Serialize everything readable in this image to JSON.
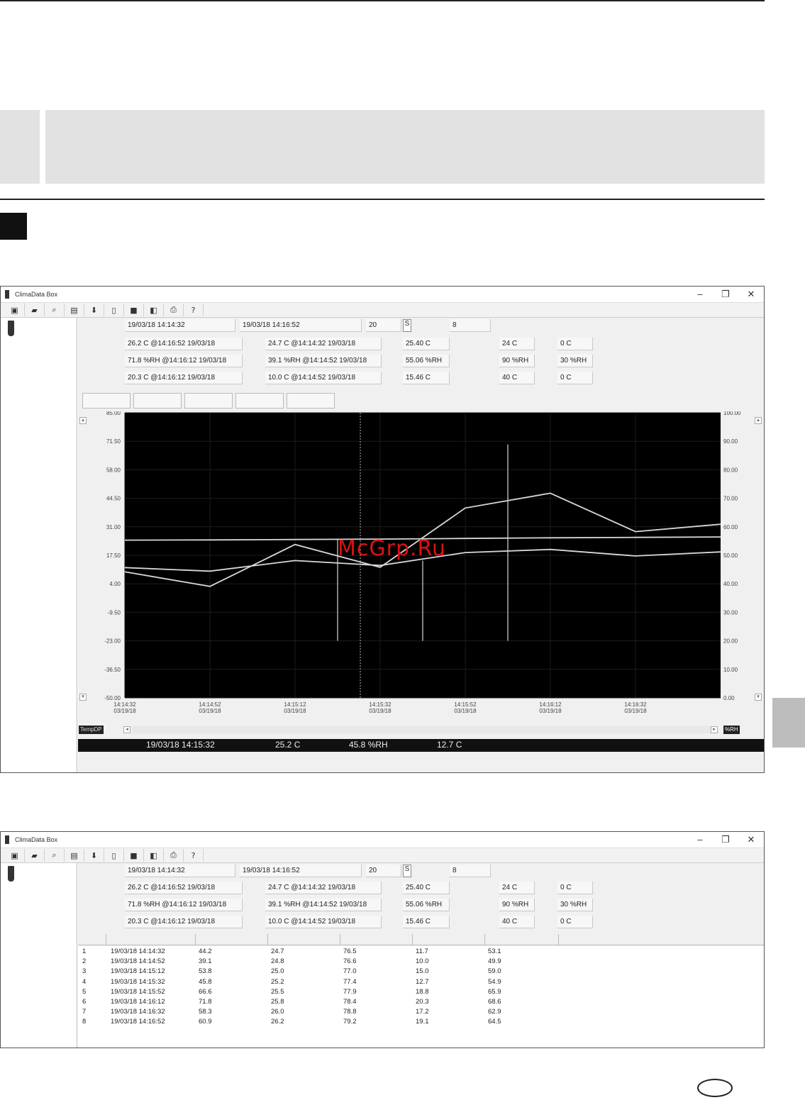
{
  "watermark": "McGrp.Ru",
  "window": {
    "title": "ClimaData Box",
    "controls": [
      "–",
      "❐",
      "✕"
    ],
    "toolbar_icons": [
      "save-icon",
      "open-icon",
      "search-device-icon",
      "memory-icon",
      "download-icon",
      "battery-icon",
      "display-icon",
      "window-icon",
      "print-icon",
      "help-icon"
    ],
    "toolbar_glyphs": [
      "▣",
      "▰",
      "⌕",
      "▤",
      "⬇",
      "▯",
      "■",
      "◧",
      "⎙",
      "?"
    ]
  },
  "summary": {
    "start": "19/03/18 14:14:32",
    "end": "19/03/18 14:16:52",
    "interval": "20",
    "interval_unit": "S",
    "count": "8",
    "rows": [
      {
        "max": "26.2 C @14:16:52 19/03/18",
        "min": "24.7 C @14:14:32 19/03/18",
        "avg": "25.40 C",
        "high": "24 C",
        "low": "0 C"
      },
      {
        "max": "71.8 %RH @14:16:12 19/03/18",
        "min": "39.1 %RH @14:14:52 19/03/18",
        "avg": "55.06 %RH",
        "high": "90 %RH",
        "low": "30 %RH"
      },
      {
        "max": "20.3 C @14:16:12 19/03/18",
        "min": "10.0 C @14:14:52 19/03/18",
        "avg": "15.46 C",
        "high": "40 C",
        "low": "0 C"
      }
    ]
  },
  "status": {
    "left_label": "TempDP",
    "time": "19/03/18 14:15:32",
    "temp": "25.2 C",
    "rh": "45.8 %RH",
    "dp": "12.7 C",
    "right_label": "%RH"
  },
  "chart_data": {
    "type": "line",
    "x": [
      "14:14:32",
      "14:14:52",
      "14:15:12",
      "14:15:32",
      "14:15:52",
      "14:16:12",
      "14:16:32",
      "14:16:52"
    ],
    "x_date": "03/19/18",
    "x_ticks": [
      "14:14:32",
      "14:14:52",
      "14:15:12",
      "14:15:32",
      "14:15:52",
      "14:16:12",
      "14:16:32"
    ],
    "y_left": {
      "range": [
        -50,
        85
      ],
      "ticks": [
        "85.00",
        "71.50",
        "58.00",
        "44.50",
        "31.00",
        "17.50",
        "4.00",
        "-9.50",
        "-23.00",
        "-36.50",
        "-50.00"
      ]
    },
    "y_right": {
      "range": [
        0,
        100
      ],
      "ticks": [
        "100.00",
        "90.00",
        "80.00",
        "70.00",
        "60.00",
        "50.00",
        "40.00",
        "30.00",
        "20.00",
        "10.00",
        "0.00"
      ]
    },
    "series": [
      {
        "axis": "right",
        "values": [
          44.2,
          39.1,
          53.8,
          45.8,
          66.6,
          71.8,
          58.3,
          60.9
        ]
      },
      {
        "axis": "left",
        "values": [
          24.7,
          24.8,
          25.0,
          25.2,
          25.5,
          25.8,
          26.0,
          26.2
        ]
      },
      {
        "axis": "left",
        "values": [
          11.7,
          10.0,
          15.0,
          12.7,
          18.8,
          20.3,
          17.2,
          19.1
        ]
      }
    ],
    "cursor_x": "14:15:32",
    "markers": [
      {
        "x": "14:15:22",
        "top": 25.0,
        "bottom": -23.0
      },
      {
        "x": "14:15:42",
        "top": 15.0,
        "bottom": -23.0
      },
      {
        "x": "14:16:02",
        "top": 70.0,
        "bottom": -23.0
      }
    ],
    "background": "#000000",
    "line_color": "#d8d8d8",
    "grid": true
  },
  "table": {
    "rows": [
      [
        "1",
        "19/03/18 14:14:32",
        "44.2",
        "24.7",
        "76.5",
        "11.7",
        "53.1"
      ],
      [
        "2",
        "19/03/18 14:14:52",
        "39.1",
        "24.8",
        "76.6",
        "10.0",
        "49.9"
      ],
      [
        "3",
        "19/03/18 14:15:12",
        "53.8",
        "25.0",
        "77.0",
        "15.0",
        "59.0"
      ],
      [
        "4",
        "19/03/18 14:15:32",
        "45.8",
        "25.2",
        "77.4",
        "12.7",
        "54.9"
      ],
      [
        "5",
        "19/03/18 14:15:52",
        "66.6",
        "25.5",
        "77.9",
        "18.8",
        "65.9"
      ],
      [
        "6",
        "19/03/18 14:16:12",
        "71.8",
        "25.8",
        "78.4",
        "20.3",
        "68.6"
      ],
      [
        "7",
        "19/03/18 14:16:32",
        "58.3",
        "26.0",
        "78.8",
        "17.2",
        "62.9"
      ],
      [
        "8",
        "19/03/18 14:16:52",
        "60.9",
        "26.2",
        "79.2",
        "19.1",
        "64.5"
      ]
    ]
  }
}
